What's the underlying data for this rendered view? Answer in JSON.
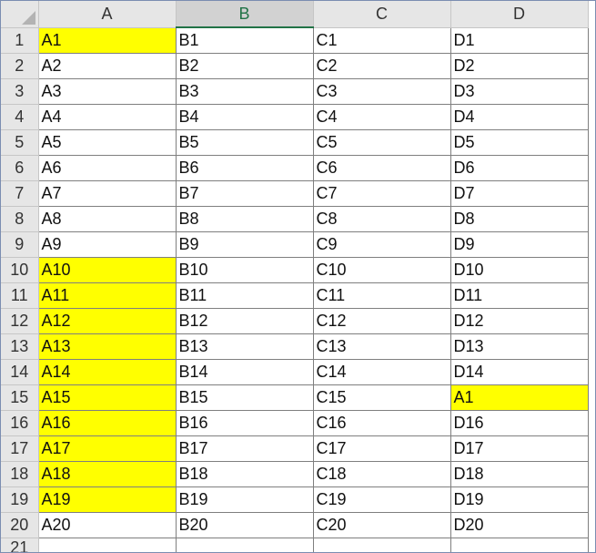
{
  "sheet": {
    "columns": [
      "A",
      "B",
      "C",
      "D"
    ],
    "active_column": "B",
    "highlight_color": "#ffff00",
    "rows": [
      {
        "num": "1",
        "cells": [
          "A1",
          "B1",
          "C1",
          "D1"
        ],
        "highlight": [
          true,
          false,
          false,
          false
        ]
      },
      {
        "num": "2",
        "cells": [
          "A2",
          "B2",
          "C2",
          "D2"
        ],
        "highlight": [
          false,
          false,
          false,
          false
        ]
      },
      {
        "num": "3",
        "cells": [
          "A3",
          "B3",
          "C3",
          "D3"
        ],
        "highlight": [
          false,
          false,
          false,
          false
        ]
      },
      {
        "num": "4",
        "cells": [
          "A4",
          "B4",
          "C4",
          "D4"
        ],
        "highlight": [
          false,
          false,
          false,
          false
        ]
      },
      {
        "num": "5",
        "cells": [
          "A5",
          "B5",
          "C5",
          "D5"
        ],
        "highlight": [
          false,
          false,
          false,
          false
        ]
      },
      {
        "num": "6",
        "cells": [
          "A6",
          "B6",
          "C6",
          "D6"
        ],
        "highlight": [
          false,
          false,
          false,
          false
        ]
      },
      {
        "num": "7",
        "cells": [
          "A7",
          "B7",
          "C7",
          "D7"
        ],
        "highlight": [
          false,
          false,
          false,
          false
        ]
      },
      {
        "num": "8",
        "cells": [
          "A8",
          "B8",
          "C8",
          "D8"
        ],
        "highlight": [
          false,
          false,
          false,
          false
        ]
      },
      {
        "num": "9",
        "cells": [
          "A9",
          "B9",
          "C9",
          "D9"
        ],
        "highlight": [
          false,
          false,
          false,
          false
        ]
      },
      {
        "num": "10",
        "cells": [
          "A10",
          "B10",
          "C10",
          "D10"
        ],
        "highlight": [
          true,
          false,
          false,
          false
        ]
      },
      {
        "num": "11",
        "cells": [
          "A11",
          "B11",
          "C11",
          "D11"
        ],
        "highlight": [
          true,
          false,
          false,
          false
        ]
      },
      {
        "num": "12",
        "cells": [
          "A12",
          "B12",
          "C12",
          "D12"
        ],
        "highlight": [
          true,
          false,
          false,
          false
        ]
      },
      {
        "num": "13",
        "cells": [
          "A13",
          "B13",
          "C13",
          "D13"
        ],
        "highlight": [
          true,
          false,
          false,
          false
        ]
      },
      {
        "num": "14",
        "cells": [
          "A14",
          "B14",
          "C14",
          "D14"
        ],
        "highlight": [
          true,
          false,
          false,
          false
        ]
      },
      {
        "num": "15",
        "cells": [
          "A15",
          "B15",
          "C15",
          "A1"
        ],
        "highlight": [
          true,
          false,
          false,
          true
        ]
      },
      {
        "num": "16",
        "cells": [
          "A16",
          "B16",
          "C16",
          "D16"
        ],
        "highlight": [
          true,
          false,
          false,
          false
        ]
      },
      {
        "num": "17",
        "cells": [
          "A17",
          "B17",
          "C17",
          "D17"
        ],
        "highlight": [
          true,
          false,
          false,
          false
        ]
      },
      {
        "num": "18",
        "cells": [
          "A18",
          "B18",
          "C18",
          "D18"
        ],
        "highlight": [
          true,
          false,
          false,
          false
        ]
      },
      {
        "num": "19",
        "cells": [
          "A19",
          "B19",
          "C19",
          "D19"
        ],
        "highlight": [
          true,
          false,
          false,
          false
        ]
      },
      {
        "num": "20",
        "cells": [
          "A20",
          "B20",
          "C20",
          "D20"
        ],
        "highlight": [
          false,
          false,
          false,
          false
        ]
      }
    ],
    "partial_row_num": "21"
  }
}
